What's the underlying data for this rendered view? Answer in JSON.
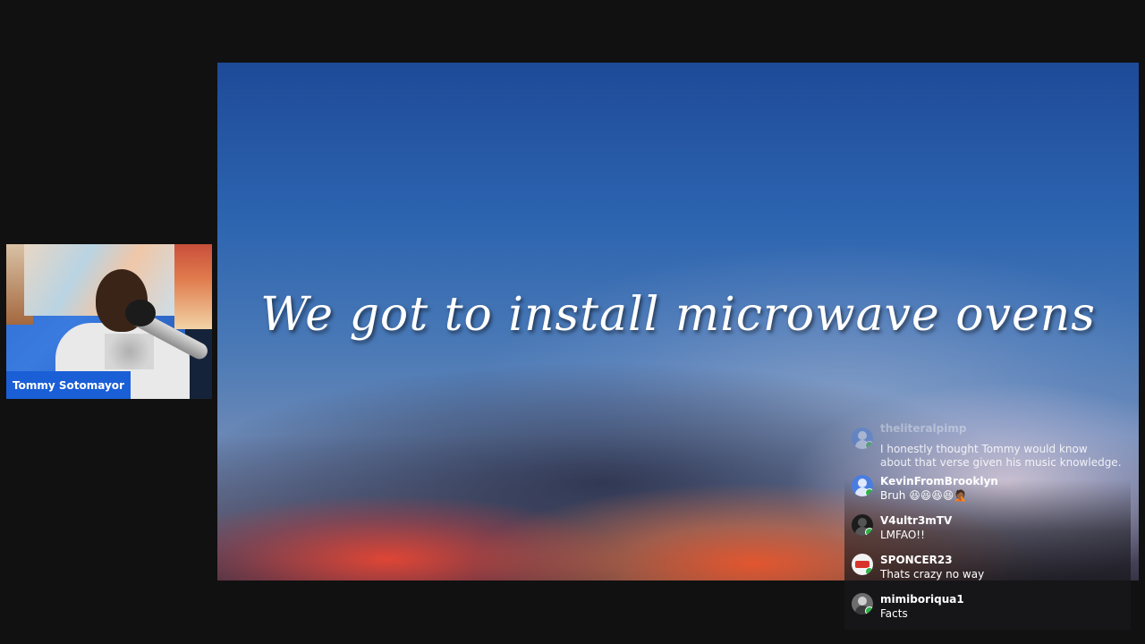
{
  "stream": {
    "lyric_caption": "We got to install microwave ovens"
  },
  "webcam": {
    "streamer_name": "Tommy Sotomayor"
  },
  "chat": {
    "messages": [
      {
        "username": "theliteralpimp",
        "text": "I honestly thought Tommy would know about that verse given his music knowledge.",
        "avatar": "person-avatar-icon",
        "faded": true
      },
      {
        "username": "KevinFromBrooklyn",
        "text": "Bruh 😆😆😆😆🤦🏾",
        "avatar": "person-avatar-icon"
      },
      {
        "username": "V4ultr3mTV",
        "text": "LMFAO!!",
        "avatar": "dark-avatar-icon"
      },
      {
        "username": "SPONCER23",
        "text": "Thats crazy no way",
        "avatar": "logo-avatar-icon"
      },
      {
        "username": "mimiboriqua1",
        "text": "Facts",
        "avatar": "photo-avatar-icon"
      }
    ]
  },
  "colors": {
    "name_tag_bg": "#1a5fd6",
    "online_badge": "#2fb24a",
    "page_bg": "#111111"
  }
}
